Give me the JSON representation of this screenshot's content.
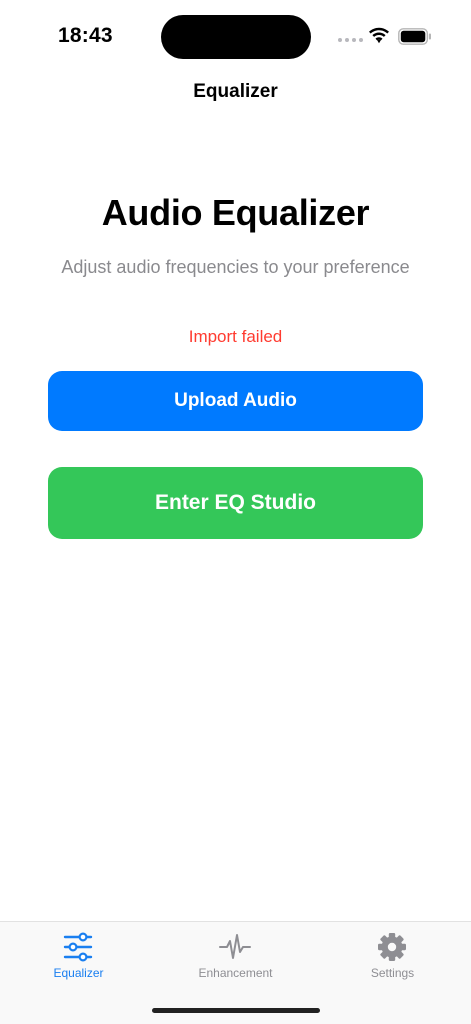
{
  "status_bar": {
    "time": "18:43",
    "icons": [
      "signal-dots",
      "wifi-icon",
      "battery-icon"
    ]
  },
  "nav": {
    "title": "Equalizer"
  },
  "main": {
    "title": "Audio Equalizer",
    "subtitle": "Adjust audio frequencies to your preference",
    "error": "Import failed",
    "upload_button": "Upload Audio",
    "studio_button": "Enter EQ Studio"
  },
  "colors": {
    "upload_button": "#007AFF",
    "studio_button": "#34C759",
    "error": "#FF3B30",
    "active_tab": "#1A7FF0",
    "inactive_tab": "#8E8E93"
  },
  "tabs": [
    {
      "label": "Equalizer",
      "icon": "sliders-icon",
      "active": true
    },
    {
      "label": "Enhancement",
      "icon": "waveform-icon",
      "active": false
    },
    {
      "label": "Settings",
      "icon": "gear-icon",
      "active": false
    }
  ]
}
